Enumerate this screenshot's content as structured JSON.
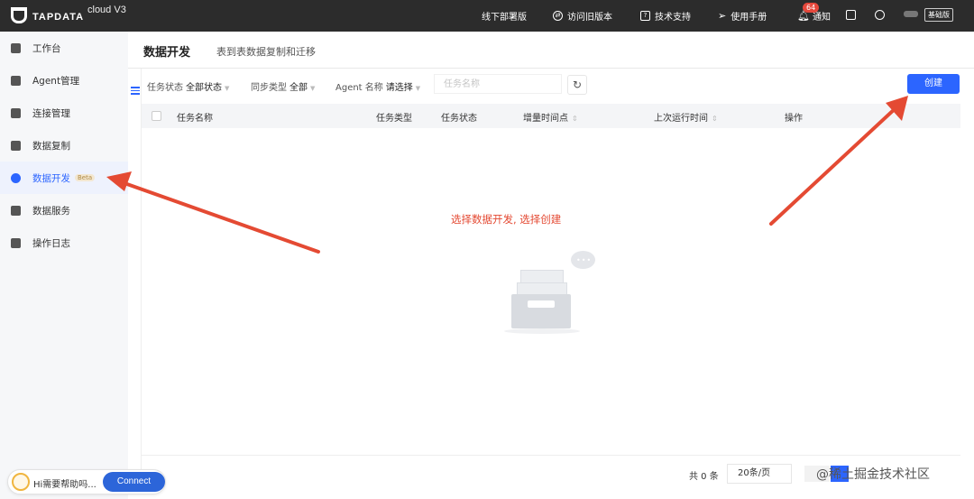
{
  "topbar": {
    "logo_text": "TAPDATA",
    "logo_sub": "cloud V3",
    "items": [
      {
        "label": "线下部署版"
      },
      {
        "label": "访问旧版本"
      },
      {
        "label": "技术支持"
      },
      {
        "label": "使用手册"
      },
      {
        "label": "通知",
        "badge": "64"
      }
    ],
    "edition": "基础版"
  },
  "sidebar": {
    "items": [
      {
        "label": "工作台",
        "icon": "dashboard-icon"
      },
      {
        "label": "Agent管理",
        "icon": "agent-icon"
      },
      {
        "label": "连接管理",
        "icon": "connection-icon"
      },
      {
        "label": "数据复制",
        "icon": "copy-icon"
      },
      {
        "label": "数据开发",
        "icon": "dev-icon",
        "badge": "Beta",
        "active": true
      },
      {
        "label": "数据服务",
        "icon": "chart-icon"
      },
      {
        "label": "操作日志",
        "icon": "log-icon"
      }
    ]
  },
  "page": {
    "title": "数据开发",
    "description": "表到表数据复制和迁移"
  },
  "filters": {
    "task_status_label": "任务状态",
    "task_status_value": "全部状态",
    "sync_type_label": "同步类型",
    "sync_type_value": "全部",
    "agent_label": "Agent 名称",
    "agent_value": "请选择",
    "name_placeholder": "任务名称",
    "create_label": "创建"
  },
  "table": {
    "columns": [
      "任务名称",
      "任务类型",
      "任务状态",
      "增量时间点",
      "上次运行时间",
      "操作"
    ]
  },
  "annotation": "选择数据开发, 选择创建",
  "pagination": {
    "total": "共 0 条",
    "page_size": "20条/页"
  },
  "watermark": "@稀土掘金技术社区",
  "help": {
    "text": "Hi需要帮助吗...",
    "connect": "Connect"
  },
  "colors": {
    "primary": "#2c65ff",
    "topbar": "#2c2c2c",
    "annotation": "#e44a33"
  }
}
